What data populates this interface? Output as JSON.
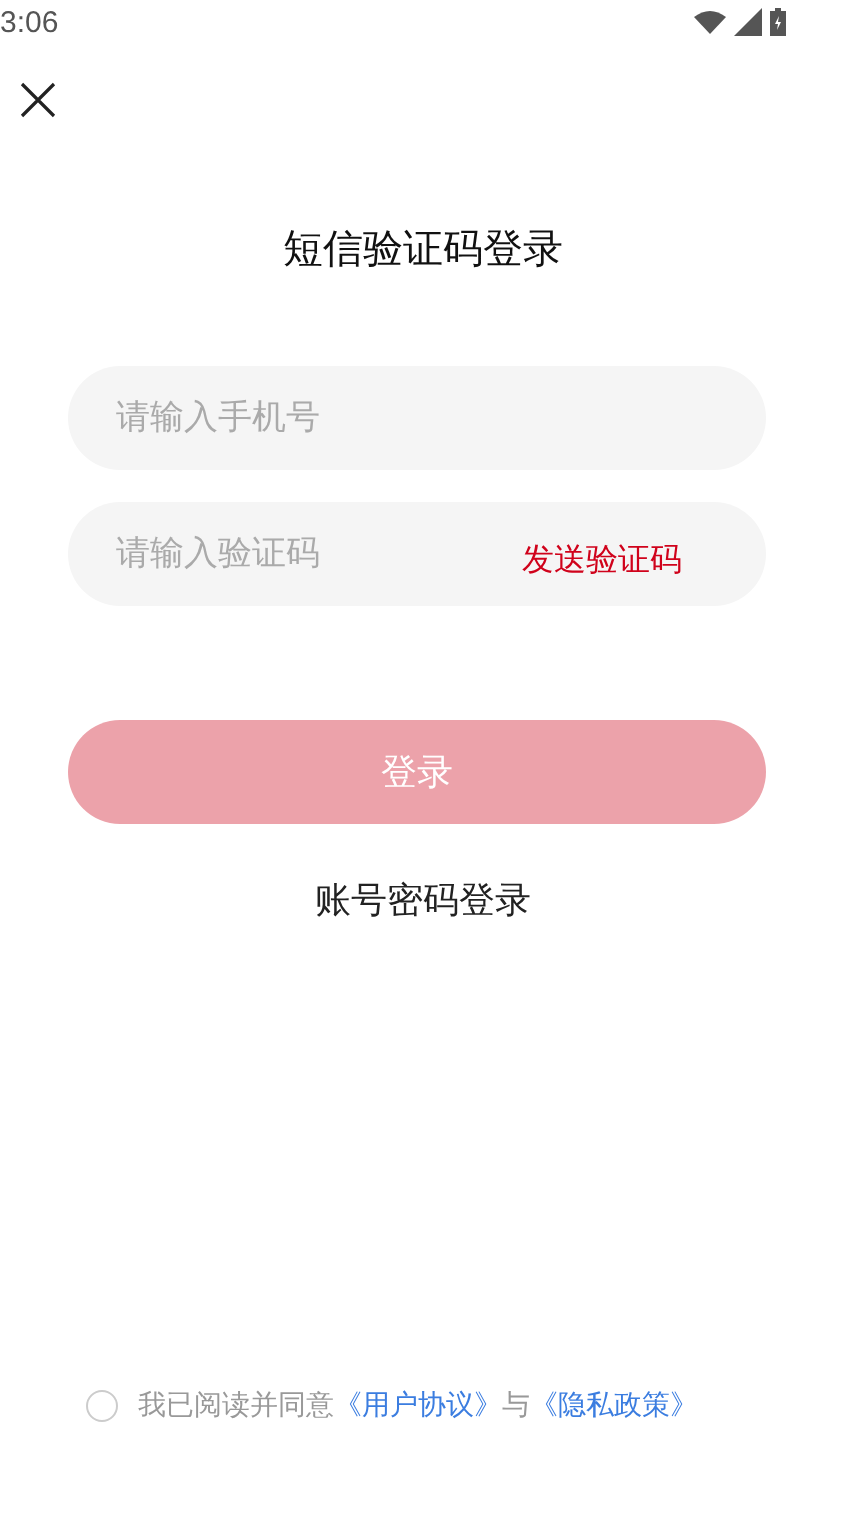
{
  "status_bar": {
    "time": "3:06"
  },
  "title": "短信验证码登录",
  "phone_field": {
    "placeholder": "请输入手机号"
  },
  "code_field": {
    "placeholder": "请输入验证码",
    "action": "发送验证码"
  },
  "login_button": {
    "label": "登录",
    "disabled": true
  },
  "alt_login": "账号密码登录",
  "agreement": {
    "checked": false,
    "prefix": "我已阅读并同意",
    "link_1": "《用户协议》",
    "joiner": "与",
    "link_2": "《隐私政策》"
  }
}
